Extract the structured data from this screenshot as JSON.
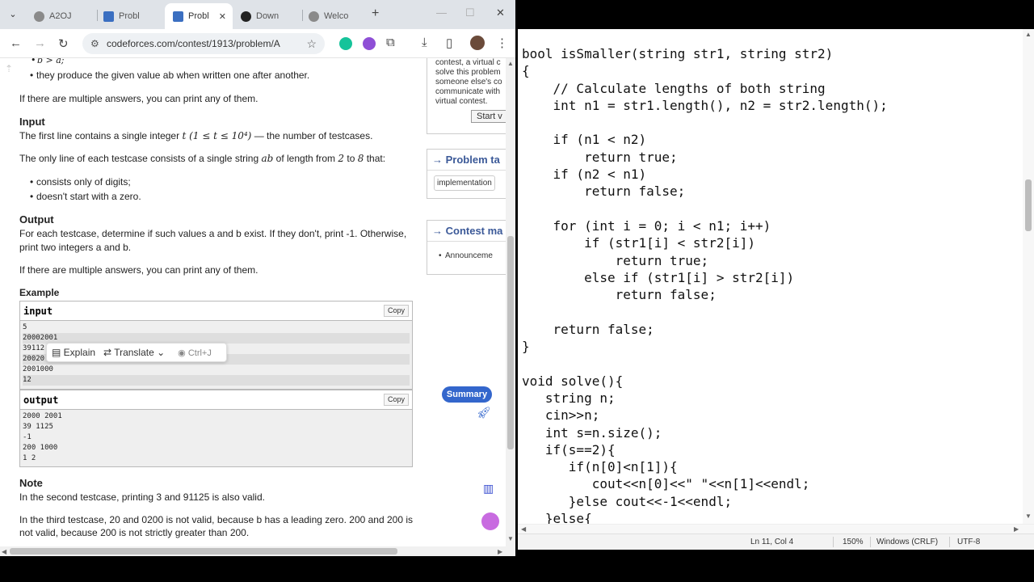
{
  "browser": {
    "tabs": [
      {
        "label": "A2OJ",
        "color": "#6b6b6b"
      },
      {
        "label": "Probl",
        "color": "#3b6fc1"
      },
      {
        "label": "Probl",
        "color": "#3b6fc1"
      },
      {
        "label": "Down",
        "color": "#222222"
      },
      {
        "label": "Welco",
        "color": "#6b6b6b"
      }
    ],
    "url": "codeforces.com/contest/1913/problem/A"
  },
  "problem": {
    "frag_top": "b > a;",
    "bullet_ab": "they produce the given value ab when written one after another.",
    "multi1": "If there are multiple answers, you can print any of them.",
    "input_heading": "Input",
    "input_line1_a": "The first line contains a single integer ",
    "input_line1_math": "t (1 ≤ t ≤ 10⁴)",
    "input_line1_b": " — the number of testcases.",
    "input_line2_a": "The only line of each testcase consists of a single string ",
    "input_line2_math": "ab",
    "input_line2_b": " of length from ",
    "input_line2_c": "2",
    "input_line2_d": " to ",
    "input_line2_e": "8",
    "input_line2_f": " that:",
    "bullet_digits": "consists only of digits;",
    "bullet_zero": "doesn't start with a zero.",
    "output_heading": "Output",
    "output_line1": "For each testcase, determine if such values a and b exist. If they don't, print -1. Otherwise,",
    "output_line2": "print two integers a and b.",
    "multi2": "If there are multiple answers, you can print any of them.",
    "example_heading": "Example",
    "input_label": "input",
    "output_label": "output",
    "copy_label": "Copy",
    "input_lines": [
      "5",
      "20002001",
      "39112",
      "20020",
      "2001000",
      "12"
    ],
    "output_lines": [
      "2000 2001",
      "39 1125",
      "-1",
      "200 1000",
      "1 2"
    ],
    "note_heading": "Note",
    "note1": "In the second testcase, printing 3 and 91125 is also valid.",
    "note2": "In the third testcase, 20 and 0200 is not valid, because b has a leading zero. 200 and 200 is",
    "note3": "not valid, because 200 is not strictly greater than 200."
  },
  "popup": {
    "explain": "Explain",
    "translate": "Translate",
    "shortcut": "Ctrl+J"
  },
  "sidebar": {
    "contest_text": [
      "contest, a virtual c",
      "solve this problem",
      "someone else's co",
      "communicate with",
      "virtual contest."
    ],
    "start_button": "Start v",
    "problem_tags_title": "→ Problem ta",
    "tag": "implementation",
    "contest_materials_title": "→ Contest ma",
    "announcement": "Announceme"
  },
  "summary_label": "Summary",
  "notepad": {
    "code": "bool isSmaller(string str1, string str2)\n{\n    // Calculate lengths of both string\n    int n1 = str1.length(), n2 = str2.length();\n\n    if (n1 < n2)\n        return true;\n    if (n2 < n1)\n        return false;\n\n    for (int i = 0; i < n1; i++)\n        if (str1[i] < str2[i])\n            return true;\n        else if (str1[i] > str2[i])\n            return false;\n\n    return false;\n}\n\nvoid solve(){\n   string n;\n   cin>>n;\n   int s=n.size();\n   if(s==2){\n      if(n[0]<n[1]){\n         cout<<n[0]<<\" \"<<n[1]<<endl;\n      }else cout<<-1<<endl;\n   }else{",
    "status": {
      "position": "Ln 11, Col 4",
      "zoom": "150%",
      "line_ending": "Windows (CRLF)",
      "encoding": "UTF-8"
    }
  }
}
